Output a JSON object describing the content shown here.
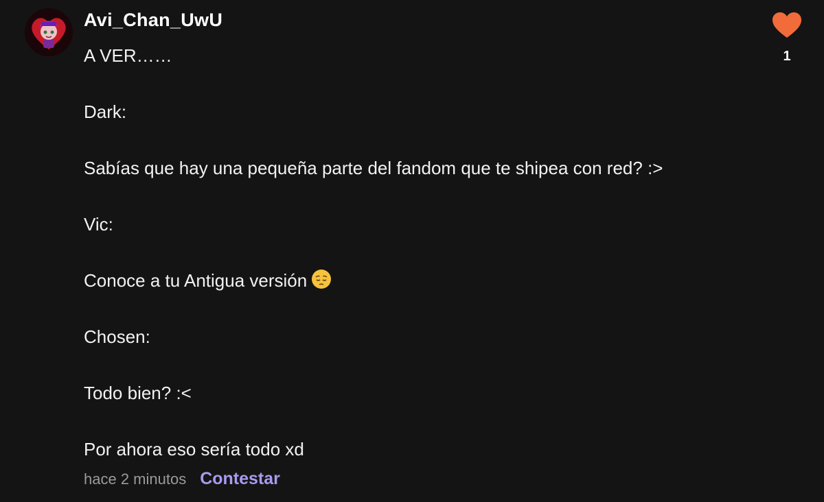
{
  "comment": {
    "username": "Avi_Chan_UwU",
    "lines": [
      "A VER……",
      "",
      "Dark:",
      "",
      "Sabías que hay una pequeña parte del fandom que te shipea con red? :>",
      "",
      "Vic:",
      "",
      "Conoce a tu Antigua versión",
      "",
      "Chosen:",
      "",
      "Todo bien? :<",
      "",
      "Por ahora eso sería todo xd"
    ],
    "timestamp": "hace 2 minutos",
    "reply_label": "Contestar",
    "like_count": "1"
  },
  "icons": {
    "like": "heart-icon",
    "emoji": "pensive-face-emoji"
  },
  "colors": {
    "background": "#141414",
    "heart": "#f26b3a",
    "reply": "#a79bf0",
    "timestamp": "#9a9a9a"
  }
}
